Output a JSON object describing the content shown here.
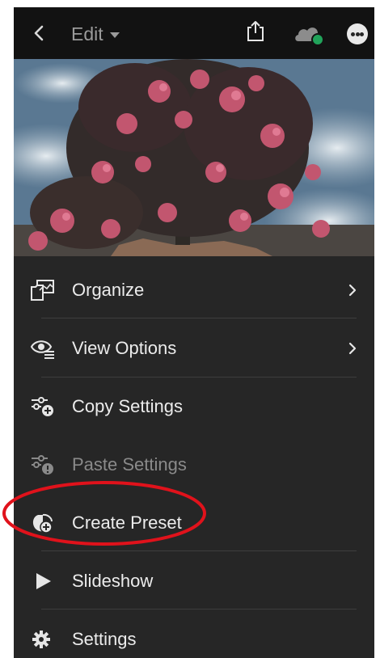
{
  "header": {
    "title": "Edit",
    "back_icon": "chevron-left-icon",
    "dropdown_icon": "caret-down-icon",
    "share_icon": "share-icon",
    "cloud_icon": "cloud-sync-icon",
    "more_icon": "more-icon"
  },
  "photo": {
    "description_icon": "photo-preview"
  },
  "menu": {
    "items": [
      {
        "label": "Organize",
        "icon": "organize-icon",
        "has_chevron": true,
        "enabled": true
      },
      {
        "label": "View Options",
        "icon": "view-options-icon",
        "has_chevron": true,
        "enabled": true
      },
      {
        "label": "Copy Settings",
        "icon": "copy-settings-icon",
        "has_chevron": false,
        "enabled": true
      },
      {
        "label": "Paste Settings",
        "icon": "paste-settings-icon",
        "has_chevron": false,
        "enabled": false
      },
      {
        "label": "Create Preset",
        "icon": "create-preset-icon",
        "has_chevron": false,
        "enabled": true,
        "annotated": true
      },
      {
        "label": "Slideshow",
        "icon": "play-icon",
        "has_chevron": false,
        "enabled": true
      },
      {
        "label": "Settings",
        "icon": "gear-icon",
        "has_chevron": false,
        "enabled": true
      }
    ]
  },
  "colors": {
    "background": "#262626",
    "topbar": "#121212",
    "text": "#ececec",
    "text_disabled": "#8a8a8a",
    "annotation": "#e0121b",
    "cloud_status": "#21a35a"
  }
}
